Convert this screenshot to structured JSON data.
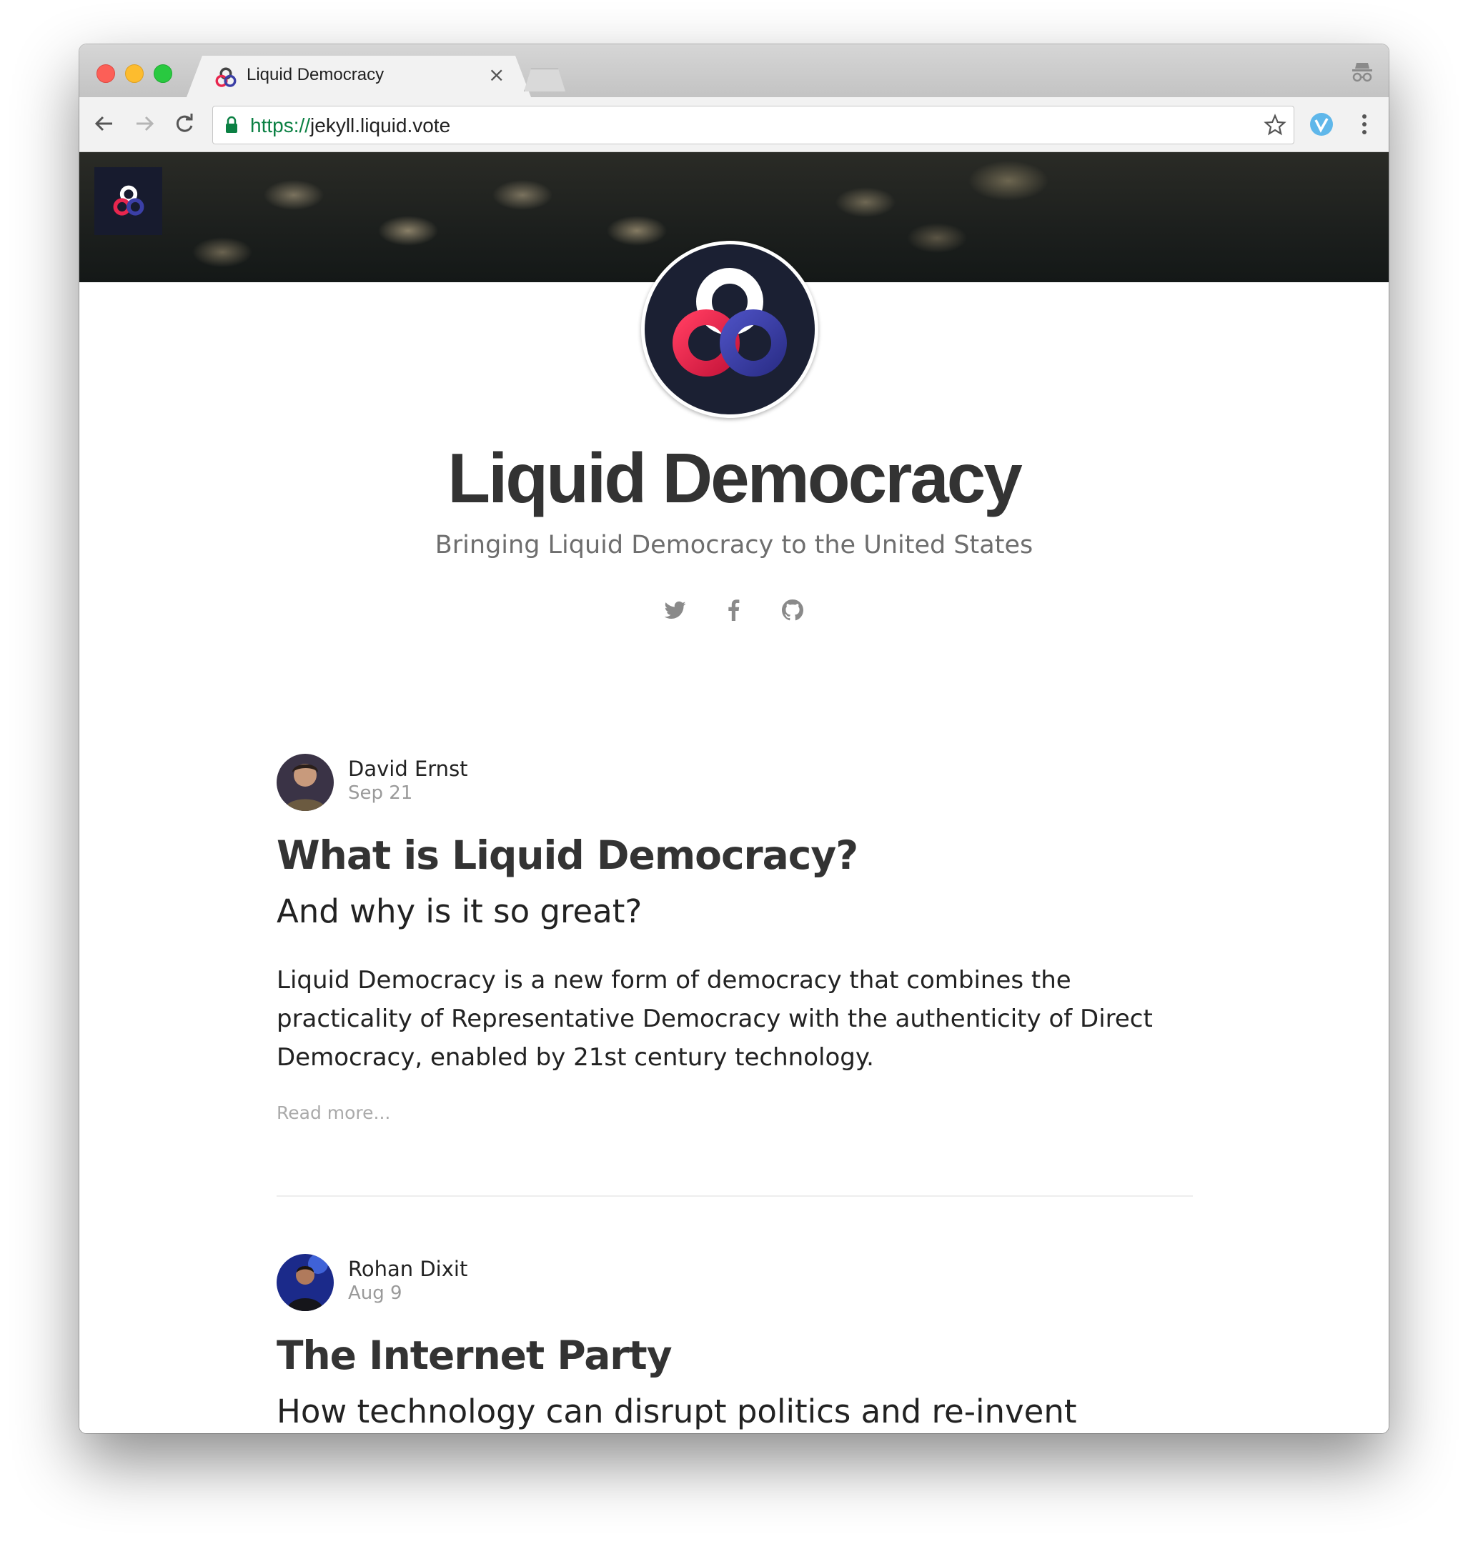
{
  "browser": {
    "tab_title": "Liquid Democracy",
    "tab_close": "×",
    "url_scheme": "https://",
    "url_host": "jekyll.liquid.vote"
  },
  "site": {
    "title": "Liquid Democracy",
    "subtitle": "Bringing Liquid Democracy to the United States",
    "social_links": [
      "twitter-icon",
      "facebook-icon",
      "github-icon"
    ]
  },
  "posts": [
    {
      "author": "David Ernst",
      "date": "Sep 21",
      "title": "What is Liquid Democracy?",
      "subtitle": "And why is it so great?",
      "excerpt": "Liquid Democracy is a new form of democracy that combines the practicality of Representative Democracy with the authenticity of Direct Democracy, enabled by 21st century technology.",
      "read_more": "Read more..."
    },
    {
      "author": "Rohan Dixit",
      "date": "Aug 9",
      "title": "The Internet Party",
      "subtitle": "How technology can disrupt politics and re-invent government"
    }
  ],
  "colors": {
    "logo_white": "#ffffff",
    "logo_red": "#e8264e",
    "logo_blue": "#3b3fa6",
    "logo_bg": "#1b2033",
    "url_secure": "#0b8043"
  }
}
